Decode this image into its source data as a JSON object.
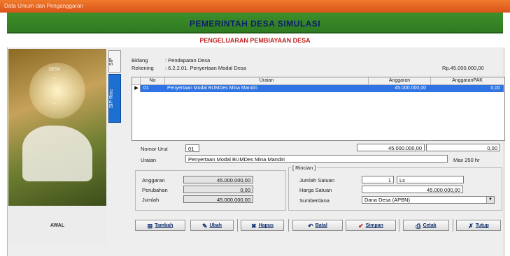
{
  "window": {
    "title": "Data Umum dan Penganggaran"
  },
  "header": {
    "title": "PEMERINTAH DESA SIMULASI",
    "subtitle": "PENGELUARAN PEMBIAYAAN DESA"
  },
  "left_panel": {
    "menu": [
      "DESA",
      "...",
      "...",
      "...",
      "..."
    ],
    "footer": "AWAL"
  },
  "tabs": [
    {
      "label": "SIP"
    },
    {
      "label": "SIP Rinc"
    }
  ],
  "info": {
    "bidang_label": "Bidang",
    "bidang_value": ": Pendapatan Desa",
    "rekening_label": "Rekening",
    "rekening_value": ": 6.2.2.01. Penyertaan Modal Desa",
    "total": "Rp.45.000.000,00"
  },
  "table": {
    "columns": [
      "No",
      "Uraian",
      "Anggaran",
      "AnggaranPAK"
    ],
    "rows": [
      {
        "pointer": "▶",
        "no": "01",
        "uraian": "Penyertaan Modal BUMDes Mina Mandiri",
        "anggaran": "45.000.000,00",
        "pak": "0,00"
      }
    ]
  },
  "form": {
    "nomor_label": "Nomor Urut",
    "nomor_value": "01",
    "amount1": "45.000.000,00",
    "amount2": "0,00",
    "uraian_label": "Uraian",
    "uraian_value": "Penyertaan Modal BUMDes Mina Mandiri",
    "uraian_note": "Max 250 hr",
    "anggaran_label": "Anggaran",
    "anggaran_value": "45.000.000,00",
    "perubahan_label": "Perubahan",
    "perubahan_value": "0,00",
    "jumlah_label": "Jumlah",
    "jumlah_value": "45.000.000,00",
    "group_title": "[ Rincian ]",
    "jumlah_satuan_label": "Jumlah Satuan",
    "jumlah_satuan_value": "1",
    "satuan_unit": "Ls",
    "harga_label": "Harga Satuan",
    "harga_value": "45.000.000,00",
    "sumber_label": "Sumberdana",
    "sumber_value": "Dana Desa (APBN)"
  },
  "buttons": [
    {
      "label": "Tambah",
      "icon": "add-icon"
    },
    {
      "label": "Ubah",
      "icon": "edit-icon"
    },
    {
      "label": "Hapus",
      "icon": "delete-icon"
    },
    {
      "label": "Batal",
      "icon": "cancel-icon"
    },
    {
      "label": "Simpan",
      "icon": "save-icon"
    },
    {
      "label": "Cetak",
      "icon": "print-icon"
    },
    {
      "label": "Tutup",
      "icon": "close-icon"
    }
  ],
  "colors": {
    "titlebar": "#e8652a",
    "green": "#3a8a2a",
    "header_text": "#0b1f6b",
    "subtitle_text": "#c02323",
    "selection": "#2f73e4"
  }
}
